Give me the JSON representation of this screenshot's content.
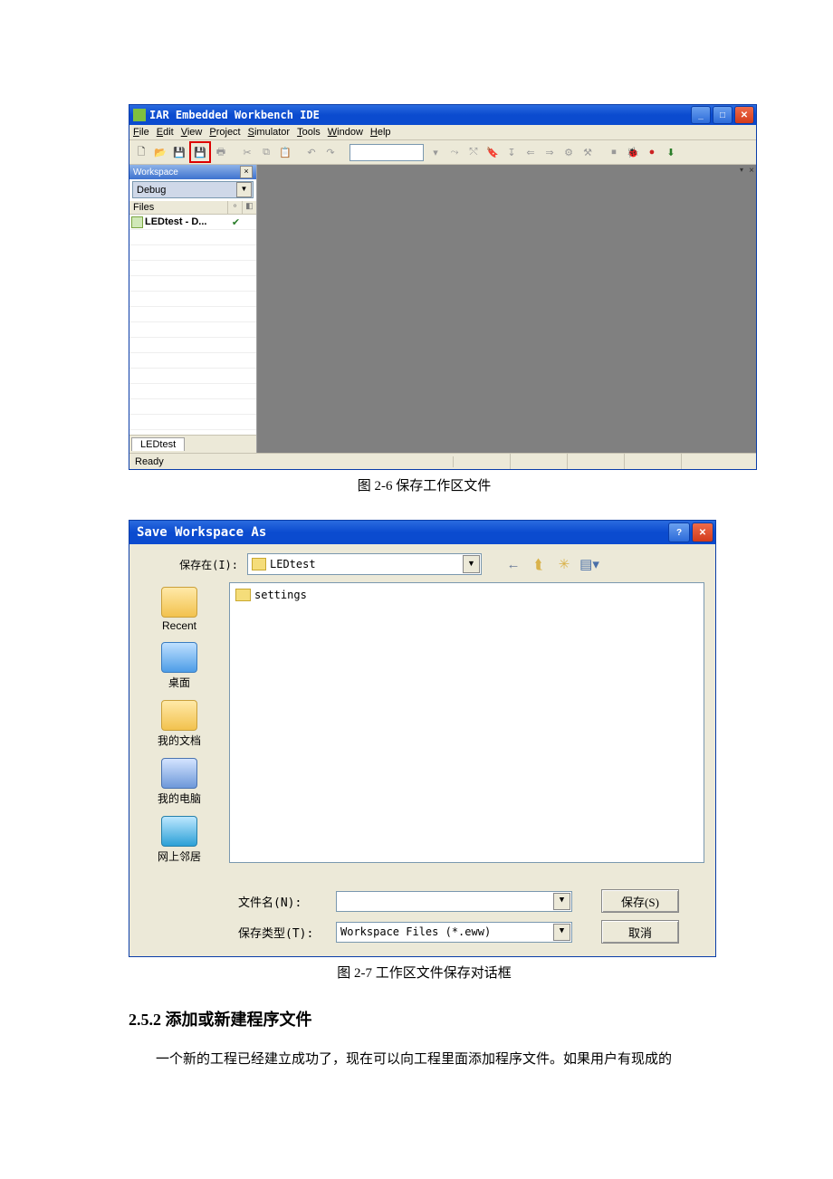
{
  "ide": {
    "title": "IAR Embedded Workbench IDE",
    "menus": [
      "File",
      "Edit",
      "View",
      "Project",
      "Simulator",
      "Tools",
      "Window",
      "Help"
    ],
    "workspace_panel_title": "Workspace",
    "config": "Debug",
    "files_header": "Files",
    "file_item": "LEDtest - D...",
    "file_item_checked": "✔",
    "tab": "LEDtest",
    "status": "Ready"
  },
  "caption1_num": "图 2-6",
  "caption1_text": " 保存工作区文件",
  "dlg": {
    "title": "Save Workspace As",
    "save_in_label": "保存在(I):",
    "folder_name": "LEDtest",
    "sidebar": {
      "recent": "Recent",
      "desktop": "桌面",
      "docs": "我的文档",
      "pc": "我的电脑",
      "net": "网上邻居"
    },
    "file_item": "settings",
    "filename_label": "文件名(N):",
    "filename_value": "",
    "filetype_label": "保存类型(T):",
    "filetype_value": "Workspace Files (*.eww)",
    "save_btn": "保存(S)",
    "cancel_btn": "取消"
  },
  "caption2_num": "图 2-7",
  "caption2_text": " 工作区文件保存对话框",
  "section_num": "2.5.2",
  "section_title": "  添加或新建程序文件",
  "para": "一个新的工程已经建立成功了，现在可以向工程里面添加程序文件。如果用户有现成的"
}
